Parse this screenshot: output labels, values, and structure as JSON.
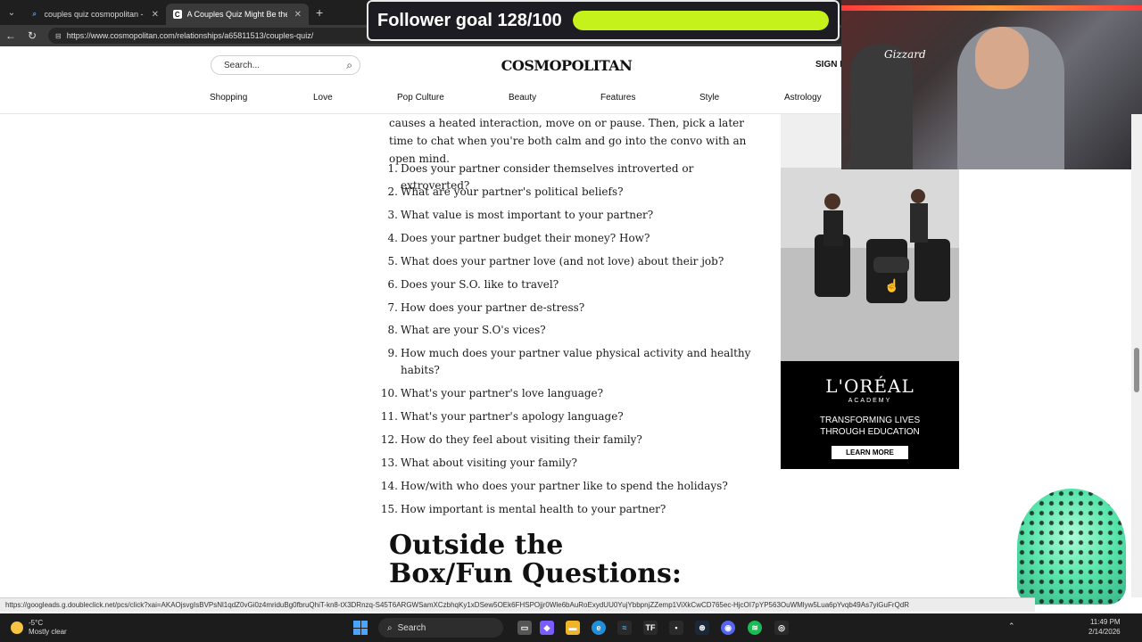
{
  "browser": {
    "tabs": [
      {
        "label": "couples quiz cosmopolitan - Searc",
        "active": false,
        "favicon": "search-icon",
        "color": "#4aa3ff"
      },
      {
        "label": "A Couples Quiz Might Be the Key",
        "active": true,
        "favicon": "C",
        "color": "#111111"
      }
    ],
    "url": "https://www.cosmopolitan.com/relationships/a65811513/couples-quiz/"
  },
  "site": {
    "search_placeholder": "Search...",
    "logo": "COSMOPOLITAN",
    "signin": "SIGN I",
    "nav": [
      "Shopping",
      "Love",
      "Pop Culture",
      "Beauty",
      "Features",
      "Style",
      "Astrology"
    ]
  },
  "article": {
    "intro": "causes a heated interaction, move on or pause. Then, pick a later time to chat when you're both calm and go into the convo with an open mind.",
    "questions": [
      {
        "num": "1.",
        "text": "Does your partner consider themselves introverted or extroverted?"
      },
      {
        "num": "2.",
        "text": "What are your partner's political beliefs?"
      },
      {
        "num": "3.",
        "text": "What value is most important to your partner?"
      },
      {
        "num": "4.",
        "text": "Does your partner budget their money? How?"
      },
      {
        "num": "5.",
        "text": "What does your partner love (and not love) about their job?"
      },
      {
        "num": "6.",
        "text": "Does your S.O. like to travel?"
      },
      {
        "num": "7.",
        "text": "How does your partner de-stress?"
      },
      {
        "num": "8.",
        "text": "What are your S.O's vices?"
      },
      {
        "num": "9.",
        "text": "How much does your partner value physical activity and healthy habits?"
      },
      {
        "num": "10.",
        "text": "What's your partner's love language?"
      },
      {
        "num": "11.",
        "text": "What's your partner's apology language?"
      },
      {
        "num": "12.",
        "text": "How do they feel about visiting their family?"
      },
      {
        "num": "13.",
        "text": "What about visiting your family?"
      },
      {
        "num": "14.",
        "text": "How/with who does your partner like to spend the holidays?"
      },
      {
        "num": "15.",
        "text": "How important is mental health to your partner?"
      }
    ],
    "section_heading": "Outside the Box/Fun Questions:"
  },
  "ad": {
    "brand": "L'ORÉAL",
    "sub": "ACADEMY",
    "tagline_line1": "TRANSFORMING LIVES",
    "tagline_line2": "THROUGH EDUCATION",
    "cta": "LEARN MORE"
  },
  "overlay": {
    "follower_label": "Follower goal 128/100",
    "follower_progress": 1.0,
    "accent": "#c6f21b",
    "webcam_sign": "Gizzard"
  },
  "status_url": "https://googleads.g.doubleclick.net/pcs/click?xai=AKAOjsvgIsBVPsNl1qdZ0vGi0z4mriduBg0fbruQhiT-kn8-tX3DRnzq-S45T6ARGWSamXCzbhqKy1xDSew5OEk6FHSPOjjr0Wle6bAuRoExydUU0YujYbbpnjZZemp1ViXkCwCD765ec-HjcOI7pYP563OuWMlyw5Lua6pYvqb49As7yiGuFrQdR",
  "taskbar": {
    "temp": "-5°C",
    "weather": "Mostly clear",
    "search": "Search",
    "time": "11:49 PM",
    "date": "2/14/2026"
  }
}
